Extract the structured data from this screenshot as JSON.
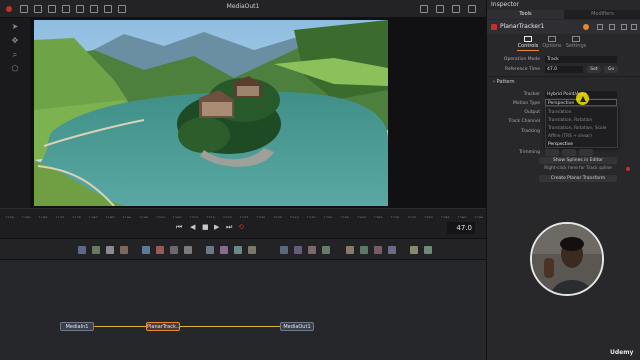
{
  "viewer": {
    "title": "MediaOut1",
    "frame_value": "47.0"
  },
  "ruler_labels": [
    "1155",
    "1160",
    "1165",
    "1170",
    "1175",
    "1180",
    "1185",
    "1190",
    "1195",
    "1200",
    "1205",
    "1210",
    "1215",
    "1220",
    "1225",
    "1230",
    "1235",
    "1240",
    "1245",
    "1250",
    "1255",
    "1260",
    "1265",
    "1270",
    "1275",
    "1280",
    "1285",
    "1290",
    "1295"
  ],
  "nodes": {
    "media_in": "MediaIn1",
    "planar": "PlanarTrack...",
    "media_out": "MediaOut1"
  },
  "inspector": {
    "title": "Inspector",
    "tabs": [
      "Tools",
      "Modifiers"
    ],
    "node_name": "PlanarTracker1",
    "subtabs": [
      "Controls",
      "Options",
      "Settings"
    ],
    "operation_mode_label": "Operation Mode",
    "operation_mode_value": "Track",
    "reference_time_label": "Reference Time",
    "reference_time_value": "47.0",
    "set_label": "Set",
    "go_label": "Go",
    "pattern_label": "Pattern",
    "tracker_label": "Tracker",
    "tracker_value": "Hybrid Point/Area",
    "motion_type_label": "Motion Type",
    "motion_type_value": "Perspective",
    "output_label": "Output",
    "track_channel_label": "Track Channel",
    "tracking_label": "Tracking",
    "trimming_label": "Trimming",
    "motion_options": [
      "Translation",
      "Translation, Rotation",
      "Translation, Rotation, Scale",
      "Affine (TRS + shear)",
      "Perspective"
    ],
    "show_splines_label": "Show Splines in Editor",
    "right_click_hint": "Right-click here for Track spline",
    "create_transform_label": "Create Planar Transform"
  },
  "watermark": "Udemy",
  "colors": {
    "accent_orange": "#e8892e",
    "selected_red": "#c4302b",
    "wire_yellow": "#d6b23a",
    "cursor_yellow": "#f3e400"
  }
}
